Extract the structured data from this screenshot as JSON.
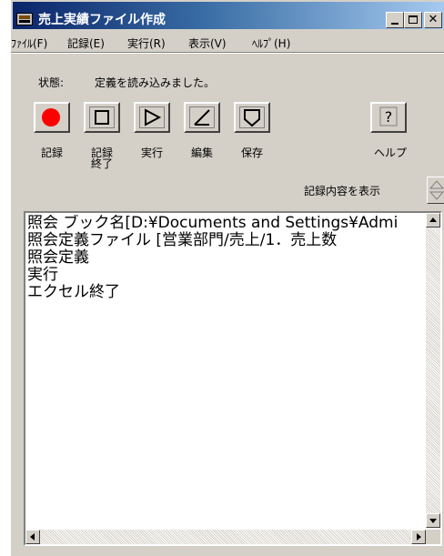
{
  "window": {
    "title": "売上実績ファイル作成"
  },
  "menu": [
    {
      "label": "ﾌｧｲﾙ(F)"
    },
    {
      "label": "記録(E)"
    },
    {
      "label": "実行(R)"
    },
    {
      "label": "表示(V)"
    },
    {
      "label": "ﾍﾙﾌﾟ(H)"
    }
  ],
  "status": {
    "label": "状態:",
    "text": "定義を読み込みました。"
  },
  "toolbar": {
    "record_label": "記録",
    "stop_label_line1": "記録",
    "stop_label_line2": "終了",
    "run_label": "実行",
    "edit_label": "編集",
    "save_label": "保存",
    "help_label": "ヘルプ"
  },
  "record_view": {
    "label": "記録内容を表示"
  },
  "log_lines": [
    "照会 ブック名[D:¥Documents and Settings¥Admi",
    "照会定義ファイル [営業部門/売上/1．売上数",
    "照会定義",
    "実行",
    "エクセル終了"
  ],
  "colors": {
    "record_dot": "#ff0000",
    "title_bar": "#0a246a"
  }
}
